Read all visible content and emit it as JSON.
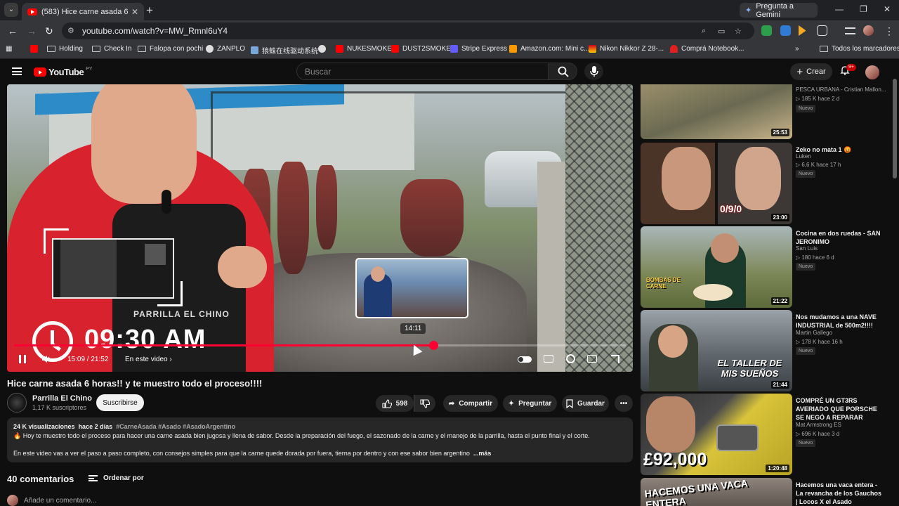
{
  "browser": {
    "tab_title": "(583) Hice carne asada 6 ho",
    "gemini_label": "Pregunta a Gemini",
    "url": "youtube.com/watch?v=MW_Rmnl6uY4",
    "bookmarks": [
      "Holding",
      "Check In",
      "Falopa con pochi",
      "ZANPLO",
      "狼蛛在线驱动系统",
      "NUKESMOKE",
      "DUST2SMOKE",
      "Stripe Express",
      "Amazon.com: Mini c...",
      "Nikon Nikkor Z 28-...",
      "Comprá Notebook..."
    ],
    "all_bookmarks": "Todos los marcadores",
    "ext_badges": [
      "25"
    ]
  },
  "yt": {
    "logo_word": "YouTube",
    "logo_country": "PY",
    "search_placeholder": "Buscar",
    "create_label": "Crear",
    "notif_count": "9+"
  },
  "video": {
    "overlay_time": "09:30 AM",
    "apron_text": "PARRILLA EL CHINO",
    "hover_time": "14:11",
    "time_current": "15:09",
    "time_total": "21:52",
    "time_display": "15:09 / 21:52",
    "chapter": "En este video",
    "progress": 0.685,
    "title": "Hice carne asada 6 horas!! y te muestro todo el proceso!!!!"
  },
  "channel": {
    "name": "Parrilla El Chino",
    "subs": "1,17 K suscriptores",
    "subscribe_label": "Suscribirse"
  },
  "actions": {
    "likes": "598",
    "share": "Compartir",
    "ask": "Preguntar",
    "save": "Guardar"
  },
  "description": {
    "views": "24 K visualizaciones",
    "age": "hace 2 días",
    "tags": "#CarneAsada #Asado #AsadoArgentino",
    "line1": "🔥 Hoy te muestro todo el proceso para hacer una carne asada bien jugosa y llena de sabor. Desde la preparación del fuego, el sazonado de la carne y el manejo de la parrilla, hasta el punto final y el corte.",
    "line2": "En este video vas a ver el paso a paso completo, con consejos simples para que la carne quede dorada por fuera, tierna por dentro y con ese sabor bien argentino",
    "more": "...más"
  },
  "comments": {
    "count": "40 comentarios",
    "order": "Ordenar por",
    "add": "Añade un comentario..."
  },
  "sidebar": [
    {
      "title": "",
      "channel": "PESCA URBANA - Cristian Mallon...",
      "stats": "185 K   hace 2 d",
      "badge": "Nuevo",
      "duration": "25:53",
      "thumb_color": "#8a7d5a"
    },
    {
      "title": "Zeko no mata 1 😡",
      "channel": "Luken",
      "stats": "6,6 K   hace 17 h",
      "badge": "Nuevo",
      "duration": "23:00",
      "thumb_text": "0/9/0",
      "thumb_color": "#3b2a22"
    },
    {
      "title": "Cocina en dos ruedas - SAN JERONIMO",
      "channel": "San Luis",
      "stats": "180   hace 6 d",
      "badge": "Nuevo",
      "duration": "21:22",
      "thumb_text": "BOMBAS DE CARNE",
      "thumb_color": "#6e7a45"
    },
    {
      "title": "Nos mudamos a una NAVE INDUSTRIAL de 500m2!!!!",
      "channel": "Martin Gallego",
      "stats": "178 K   hace 16 h",
      "badge": "Nuevo",
      "duration": "21:44",
      "thumb_text": "EL TALLER DE MIS SUEÑOS",
      "thumb_color": "#5e6a73"
    },
    {
      "title": "COMPRÉ UN GT3RS AVERIADO QUE PORSCHE SE NEGÓ A REPARAR",
      "channel": "Mat Armstrong ES",
      "stats": "696 K   hace 3 d",
      "badge": "Nuevo",
      "duration": "1:20:48",
      "thumb_text": "£92,000",
      "thumb_color": "#c9b52a"
    },
    {
      "title": "Hacemos una vaca entera - La revancha de los Gauchos | Locos X el Asado",
      "channel": "",
      "stats": "",
      "badge": "",
      "duration": "",
      "thumb_text": "HACEMOS UNA VACA ENTERA",
      "thumb_color": "#7a6d66"
    }
  ]
}
